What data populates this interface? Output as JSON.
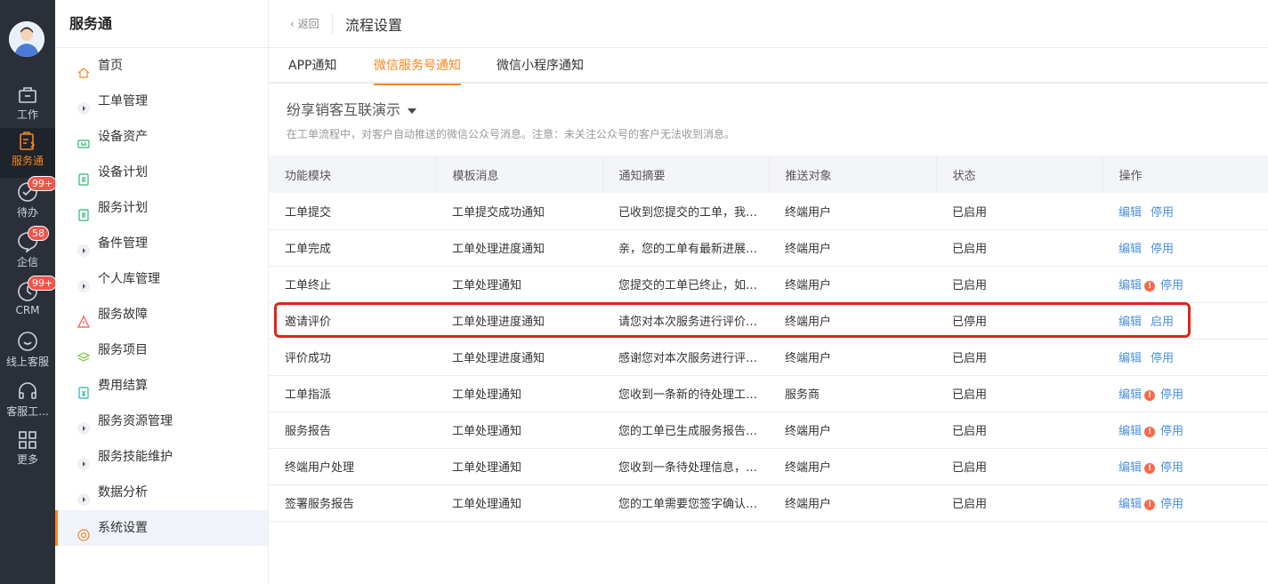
{
  "rail": {
    "items": [
      {
        "label": "工作",
        "icon": "briefcase-icon"
      },
      {
        "label": "服务通",
        "icon": "service-clipboard-icon",
        "active": true
      },
      {
        "label": "待办",
        "icon": "check-circle-icon",
        "badge": "99+"
      },
      {
        "label": "企信",
        "icon": "chat-bubble-icon",
        "badge": "58"
      },
      {
        "label": "CRM",
        "icon": "clock-icon",
        "badge": "99+"
      },
      {
        "label": "线上客服",
        "icon": "smile-chat-icon"
      },
      {
        "label": "客服工...",
        "icon": "headset-icon"
      },
      {
        "label": "更多",
        "icon": "grid-icon"
      }
    ]
  },
  "sidebar": {
    "title": "服务通",
    "items": [
      {
        "label": "首页",
        "icon": "home-icon"
      },
      {
        "label": "工单管理",
        "icon": "expand-arrow-icon"
      },
      {
        "label": "设备资产",
        "icon": "device-icon"
      },
      {
        "label": "设备计划",
        "icon": "document-icon"
      },
      {
        "label": "服务计划",
        "icon": "document-icon"
      },
      {
        "label": "备件管理",
        "icon": "expand-arrow-icon"
      },
      {
        "label": "个人库管理",
        "icon": "expand-arrow-icon"
      },
      {
        "label": "服务故障",
        "icon": "warning-icon"
      },
      {
        "label": "服务项目",
        "icon": "layers-icon"
      },
      {
        "label": "费用结算",
        "icon": "receipt-icon"
      },
      {
        "label": "服务资源管理",
        "icon": "expand-arrow-icon"
      },
      {
        "label": "服务技能维护",
        "icon": "expand-arrow-icon"
      },
      {
        "label": "数据分析",
        "icon": "expand-arrow-icon"
      },
      {
        "label": "系统设置",
        "icon": "gear-icon",
        "active": true
      }
    ]
  },
  "header": {
    "back_label": "返回",
    "title": "流程设置"
  },
  "tabs": [
    {
      "label": "APP通知"
    },
    {
      "label": "微信服务号通知",
      "active": true
    },
    {
      "label": "微信小程序通知"
    }
  ],
  "account": {
    "name": "纷享销客互联演示"
  },
  "hint": "在工单流程中，对客户自动推送的微信公众号消息。注意：未关注公众号的客户无法收到消息。",
  "table": {
    "columns": [
      "功能模块",
      "模板消息",
      "通知摘要",
      "推送对象",
      "状态",
      "操作"
    ],
    "rows": [
      {
        "module": "工单提交",
        "template": "工单提交成功通知",
        "summary": "已收到您提交的工单，我…",
        "target": "终端用户",
        "status": "已启用",
        "edit": "编辑",
        "toggle": "停用",
        "warn": false
      },
      {
        "module": "工单完成",
        "template": "工单处理进度通知",
        "summary": "亲，您的工单有最新进展…",
        "target": "终端用户",
        "status": "已启用",
        "edit": "编辑",
        "toggle": "停用",
        "warn": false
      },
      {
        "module": "工单终止",
        "template": "工单处理通知",
        "summary": "您提交的工单已终止，如…",
        "target": "终端用户",
        "status": "已启用",
        "edit": "编辑",
        "toggle": "停用",
        "warn": true
      },
      {
        "module": "邀请评价",
        "template": "工单处理进度通知",
        "summary": "请您对本次服务进行评价…",
        "target": "终端用户",
        "status": "已停用",
        "edit": "编辑",
        "toggle": "启用",
        "warn": false
      },
      {
        "module": "评价成功",
        "template": "工单处理进度通知",
        "summary": "感谢您对本次服务进行评…",
        "target": "终端用户",
        "status": "已启用",
        "edit": "编辑",
        "toggle": "停用",
        "warn": false
      },
      {
        "module": "工单指派",
        "template": "工单处理通知",
        "summary": "您收到一条新的待处理工…",
        "target": "服务商",
        "status": "已启用",
        "edit": "编辑",
        "toggle": "停用",
        "warn": true
      },
      {
        "module": "服务报告",
        "template": "工单处理通知",
        "summary": "您的工单已生成服务报告…",
        "target": "终端用户",
        "status": "已启用",
        "edit": "编辑",
        "toggle": "停用",
        "warn": true
      },
      {
        "module": "终端用户处理",
        "template": "工单处理通知",
        "summary": "您收到一条待处理信息，…",
        "target": "终端用户",
        "status": "已启用",
        "edit": "编辑",
        "toggle": "停用",
        "warn": true
      },
      {
        "module": "签署服务报告",
        "template": "工单处理通知",
        "summary": "您的工单需要您签字确认…",
        "target": "终端用户",
        "status": "已启用",
        "edit": "编辑",
        "toggle": "停用",
        "warn": true
      }
    ]
  },
  "colors": {
    "accent": "#f5871f",
    "link": "#4a90e2",
    "warning": "#f56a4a",
    "highlight": "#e0241b",
    "rail_bg": "#2a2f3a"
  }
}
